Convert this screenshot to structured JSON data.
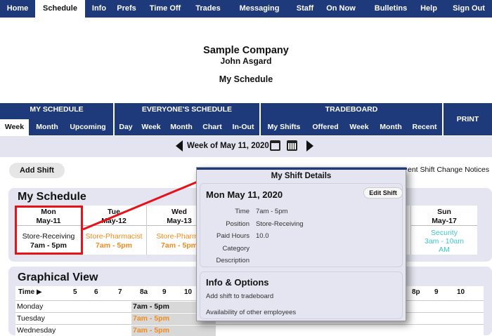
{
  "topnav": [
    "Home",
    "Schedule",
    "Info",
    "Prefs",
    "Time Off",
    "Trades",
    "Messaging",
    "Staff",
    "On Now",
    "Bulletins",
    "Help",
    "Sign Out"
  ],
  "header": {
    "company": "Sample Company",
    "user": "John Asgard",
    "page": "My Schedule"
  },
  "subnav": {
    "groups": [
      "MY SCHEDULE",
      "EVERYONE'S SCHEDULE",
      "TRADEBOARD"
    ],
    "print": "PRINT",
    "my_schedule": [
      "Week",
      "Month",
      "Upcoming"
    ],
    "everyone": [
      "Day",
      "Week",
      "Month",
      "Chart",
      "In-Out"
    ],
    "tradeboard": [
      "My Shifts",
      "Offered",
      "Week",
      "Month",
      "Recent"
    ]
  },
  "weekbar": {
    "label": "Week of May 11, 2020"
  },
  "actions": {
    "add_shift": "Add Shift",
    "notices": "ent Shift Change Notices"
  },
  "my_schedule": {
    "title": "My Schedule",
    "days": [
      {
        "name": "Mon",
        "date": "May-11",
        "shift": "Store-Receiving",
        "time": "7am - 5pm",
        "color": "#111111"
      },
      {
        "name": "Tue",
        "date": "May-12",
        "shift": "Store-Pharmacist",
        "time": "7am - 5pm",
        "color": "#f28a1c"
      },
      {
        "name": "Wed",
        "date": "May-13",
        "shift": "Store-Pharma",
        "time": "7am - 5pm",
        "color": "#f28a1c"
      },
      {
        "name": "Sun",
        "date": "May-17",
        "shift": "Security",
        "time": "3am - 10am",
        "time2": "AM",
        "color": "#3fc7c9"
      }
    ]
  },
  "graphical": {
    "title": "Graphical View",
    "time_header": "Time ▶",
    "hours": [
      "5",
      "6",
      "7",
      "8a",
      "9",
      "10",
      "8p",
      "9",
      "10"
    ],
    "rows": [
      {
        "day": "Monday",
        "shift": "7am - 5pm",
        "color": "#111111"
      },
      {
        "day": "Tuesday",
        "shift": "7am - 5pm",
        "color": "#f28a1c"
      },
      {
        "day": "Wednesday",
        "shift": "7am - 5pm",
        "color": "#f28a1c"
      }
    ]
  },
  "popup": {
    "title": "My Shift Details",
    "date": "Mon May 11, 2020",
    "edit": "Edit Shift",
    "fields": [
      {
        "label": "Time",
        "value": "7am - 5pm"
      },
      {
        "label": "Position",
        "value": "Store-Receiving"
      },
      {
        "label": "Paid Hours",
        "value": "10.0"
      },
      {
        "label": "Category",
        "value": ""
      },
      {
        "label": "Description",
        "value": ""
      }
    ],
    "info_title": "Info & Options",
    "options": [
      "Add shift to tradeboard",
      "Availability of other employees"
    ]
  },
  "colors": {
    "nav": "#1f3a7a",
    "panel": "#e4e5f0",
    "highlight": "#e8111a",
    "orange": "#f28a1c",
    "teal": "#3fc7c9"
  },
  "icons": [
    "prev-week-icon",
    "next-week-icon",
    "calendar-check-icon",
    "calendar-grid-icon"
  ]
}
